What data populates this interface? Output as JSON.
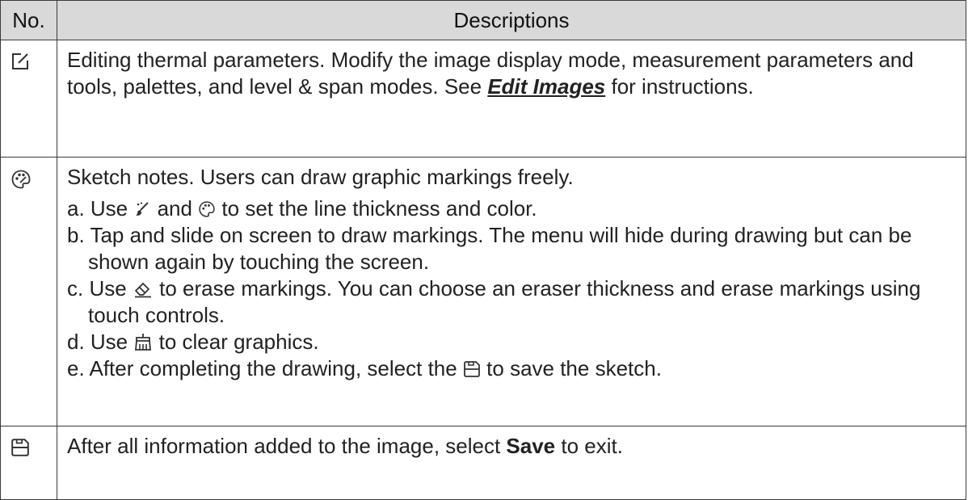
{
  "header": {
    "col_no": "No.",
    "col_desc": "Descriptions"
  },
  "rows": [
    {
      "icon": "edit-icon",
      "text_before": "Editing thermal parameters. Modify the image display mode, measurement parameters and tools, palettes, and level & span modes. See ",
      "link": "Edit Images",
      "text_after": " for instructions."
    },
    {
      "icon": "palette-icon",
      "intro": "Sketch notes. Users can draw graphic markings freely.",
      "steps": {
        "a": {
          "prefix": "a. Use ",
          "icon1": "brush-icon",
          "mid": " and ",
          "icon2": "palette-icon",
          "suffix": " to set the line thickness and color."
        },
        "b": {
          "text": "b. Tap and slide on screen to draw markings. The menu will hide during drawing but can be shown again by touching the screen."
        },
        "c": {
          "prefix": "c. Use ",
          "icon": "eraser-icon",
          "suffix": " to erase markings. You can choose an eraser thickness and erase markings using touch controls."
        },
        "d": {
          "prefix": "d. Use ",
          "icon": "clear-broom-icon",
          "suffix": " to clear graphics."
        },
        "e": {
          "prefix": "e. After completing the drawing, select the ",
          "icon": "save-icon",
          "suffix": " to save the sketch."
        }
      }
    },
    {
      "icon": "save-icon",
      "text_before": "After all information added to the image, select ",
      "bold": "Save",
      "text_after": " to exit."
    }
  ]
}
